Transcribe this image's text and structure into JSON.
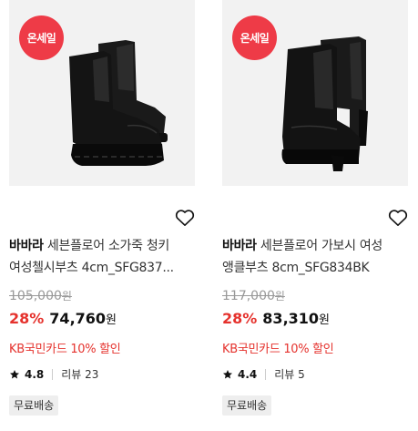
{
  "products": [
    {
      "badge": "온세일",
      "brand": "바바라",
      "title_line1": "세븐플로어 소가죽 청키",
      "title_line2": "여성첼시부츠 4cm_SFG837...",
      "original_price": "105,000",
      "original_currency": "원",
      "discount_rate": "28%",
      "sale_price": "74,760",
      "sale_currency": "원",
      "card_promo": "KB국민카드 10% 할인",
      "rating": "4.8",
      "review_label": "리뷰 23",
      "shipping": "무료배송",
      "image_icon": "chelsea-boot-chunky"
    },
    {
      "badge": "온세일",
      "brand": "바바라",
      "title_line1": "세븐플로어 가보시 여성",
      "title_line2": "앵클부츠 8cm_SFG834BK",
      "original_price": "117,000",
      "original_currency": "원",
      "discount_rate": "28%",
      "sale_price": "83,310",
      "sale_currency": "원",
      "card_promo": "KB국민카드 10% 할인",
      "rating": "4.4",
      "review_label": "리뷰 5",
      "shipping": "무료배송",
      "image_icon": "ankle-boot-heel"
    }
  ],
  "colors": {
    "accent": "#e5322d",
    "badge": "#ee3b47",
    "thumb_bg": "#f2f2f2"
  }
}
